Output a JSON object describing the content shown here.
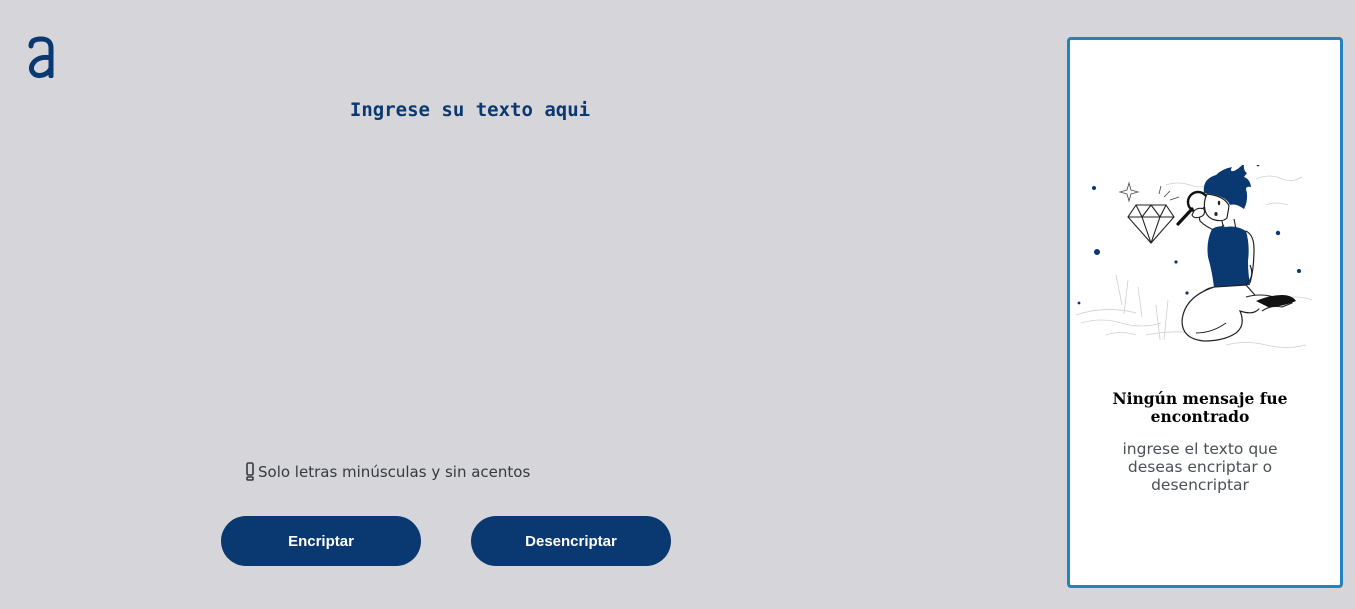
{
  "colors": {
    "background": "#d6d6da",
    "primary": "#0a3871",
    "panel_border": "#2283c0",
    "panel_bg": "#ffffff"
  },
  "logo": {
    "icon": "alura-a-logo"
  },
  "input": {
    "placeholder": "Ingrese su texto aqui",
    "value": ""
  },
  "hint": {
    "icon": "exclamation-icon",
    "text": "Solo letras minúsculas y sin acentos"
  },
  "buttons": {
    "encrypt_label": "Encriptar",
    "decrypt_label": "Desencriptar"
  },
  "output_panel": {
    "illustration": "boy-with-magnifying-glass-illustration",
    "title": "Ningún mensaje fue encontrado",
    "message": "ingrese el texto que deseas encriptar o desencriptar"
  }
}
